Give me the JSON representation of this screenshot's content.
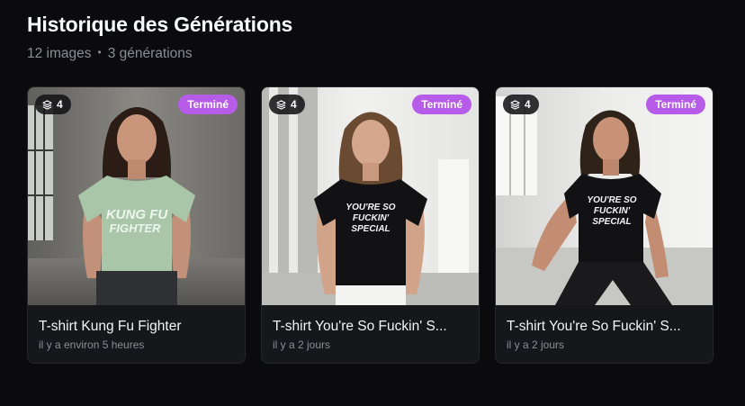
{
  "header": {
    "title": "Historique des Générations",
    "image_count": "12 images",
    "separator": "•",
    "generation_count": "3 générations"
  },
  "cards": [
    {
      "count": "4",
      "status": "Terminé",
      "title": "T-shirt Kung Fu Fighter",
      "date": "il y a environ 5 heures",
      "shirt_print": "KUNG FU FIGHTER",
      "shirt_color": "#a9c7a8"
    },
    {
      "count": "4",
      "status": "Terminé",
      "title": "T-shirt You're So Fuckin' S...",
      "date": "il y a 2 jours",
      "shirt_print": "YOU'RE SO FUCKIN' SPECIAL",
      "shirt_color": "#121214"
    },
    {
      "count": "4",
      "status": "Terminé",
      "title": "T-shirt You're So Fuckin' S...",
      "date": "il y a 2 jours",
      "shirt_print": "YOU'RE SO FUCKIN' SPECIAL",
      "shirt_color": "#121214"
    }
  ],
  "colors": {
    "background": "#0b0b0d",
    "card": "#16171b",
    "status_badge": "#b65ce8",
    "muted_text": "#8b8d96"
  },
  "icons": {
    "count_badge": "layers-icon"
  }
}
